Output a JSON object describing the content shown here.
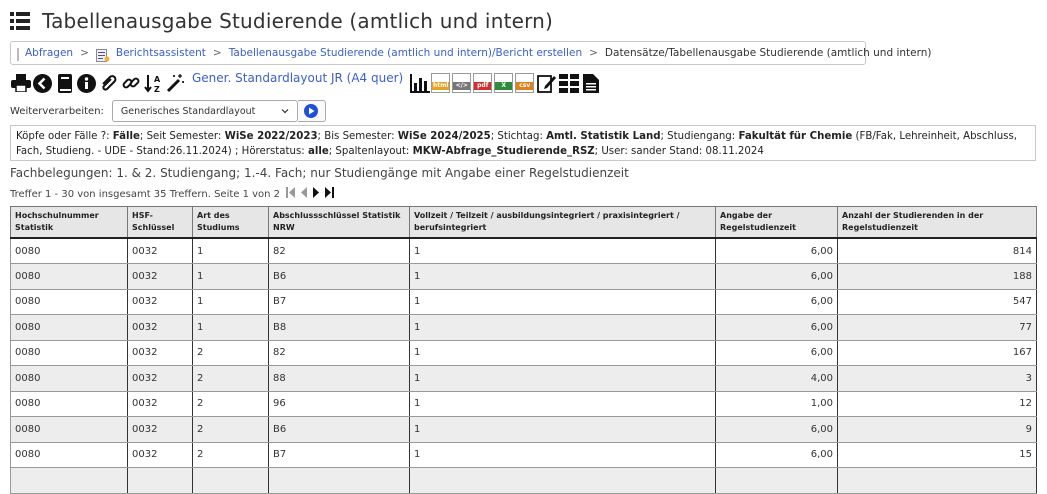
{
  "page": {
    "title": "Tabellenausgabe Studierende (amtlich und intern)"
  },
  "breadcrumb": {
    "items": [
      {
        "label": "Abfragen",
        "link": true
      },
      {
        "label": "Berichtsassistent",
        "link": true
      },
      {
        "label": "Tabellenausgabe Studierende (amtlich und intern)/Bericht erstellen",
        "link": true
      },
      {
        "label": "Datensätze/Tabellenausgabe Studierende (amtlich und intern)",
        "link": false
      }
    ]
  },
  "toolbar": {
    "layout_link": "Gener. Standardlayout JR (A4 quer)",
    "icons": [
      "print-icon",
      "back-icon",
      "book-icon",
      "info-icon",
      "attachment-icon",
      "link-icon",
      "sort-icon",
      "magic-wand-icon"
    ],
    "formats": [
      {
        "name": "chart-icon",
        "label": ""
      },
      {
        "name": "html-icon",
        "label": "html",
        "color": "#e8a020"
      },
      {
        "name": "xml-icon",
        "label": "</>",
        "color": "#777777"
      },
      {
        "name": "pdf-icon",
        "label": "pdf",
        "color": "#d03030"
      },
      {
        "name": "excel-icon",
        "label": "X",
        "color": "#2e8b3a"
      },
      {
        "name": "csv-icon",
        "label": "csv",
        "color": "#e08020"
      },
      {
        "name": "edit-icon",
        "label": ""
      },
      {
        "name": "table-icon",
        "label": ""
      },
      {
        "name": "document-icon",
        "label": ""
      }
    ]
  },
  "weiter": {
    "label": "Weiterverarbeiten:",
    "selected": "Generisches Standardlayout"
  },
  "params": {
    "p1": "Köpfe oder Fälle ?:",
    "v1": "Fälle",
    "p2": "; Seit Semester:",
    "v2": "WiSe 2022/2023",
    "p3": "; Bis Semester:",
    "v3": "WiSe 2024/2025",
    "p4": "; Stichtag:",
    "v4": "Amtl. Statistik Land",
    "p5": "; Studiengang:",
    "v5": "Fakultät für Chemie",
    "p6": "(FB/Fak, Lehreinheit, Abschluss, Fach, Studieng. - UDE - Stand:26.11.2024) ; Hörerstatus:",
    "v6": "alle",
    "p7": "; Spaltenlayout:",
    "v7": "MKW-Abfrage_Studierende_RSZ",
    "p8": "; User: sander Stand: 08.11.2024"
  },
  "subtitle": "Fachbelegungen: 1. & 2. Studiengang; 1.-4. Fach; nur Studiengänge mit Angabe einer Regelstudienzeit",
  "hits": "Treffer 1 - 30 von insgesamt 35 Treffern. Seite 1 von 2",
  "table": {
    "headers": [
      "Hochschulnummer Statistik",
      "HSF-Schlüssel",
      "Art des Studiums",
      "Abschlussschlüssel Statistik NRW",
      "Vollzeit / Teilzeit / ausbildungsintegriert / praxisintegriert / berufsintegriert",
      "Angabe der Regelstudienzeit",
      "Anzahl der Studierenden in der Regelstudienzeit"
    ],
    "rows": [
      [
        "0080",
        "0032",
        "1",
        "82",
        "1",
        "6,00",
        "814"
      ],
      [
        "0080",
        "0032",
        "1",
        "B6",
        "1",
        "6,00",
        "188"
      ],
      [
        "0080",
        "0032",
        "1",
        "B7",
        "1",
        "6,00",
        "547"
      ],
      [
        "0080",
        "0032",
        "1",
        "B8",
        "1",
        "6,00",
        "77"
      ],
      [
        "0080",
        "0032",
        "2",
        "82",
        "1",
        "6,00",
        "167"
      ],
      [
        "0080",
        "0032",
        "2",
        "88",
        "1",
        "4,00",
        "3"
      ],
      [
        "0080",
        "0032",
        "2",
        "96",
        "1",
        "1,00",
        "12"
      ],
      [
        "0080",
        "0032",
        "2",
        "B6",
        "1",
        "6,00",
        "9"
      ],
      [
        "0080",
        "0032",
        "2",
        "B7",
        "1",
        "6,00",
        "15"
      ],
      [
        "",
        "",
        "",
        "",
        "",
        "",
        ""
      ]
    ]
  }
}
